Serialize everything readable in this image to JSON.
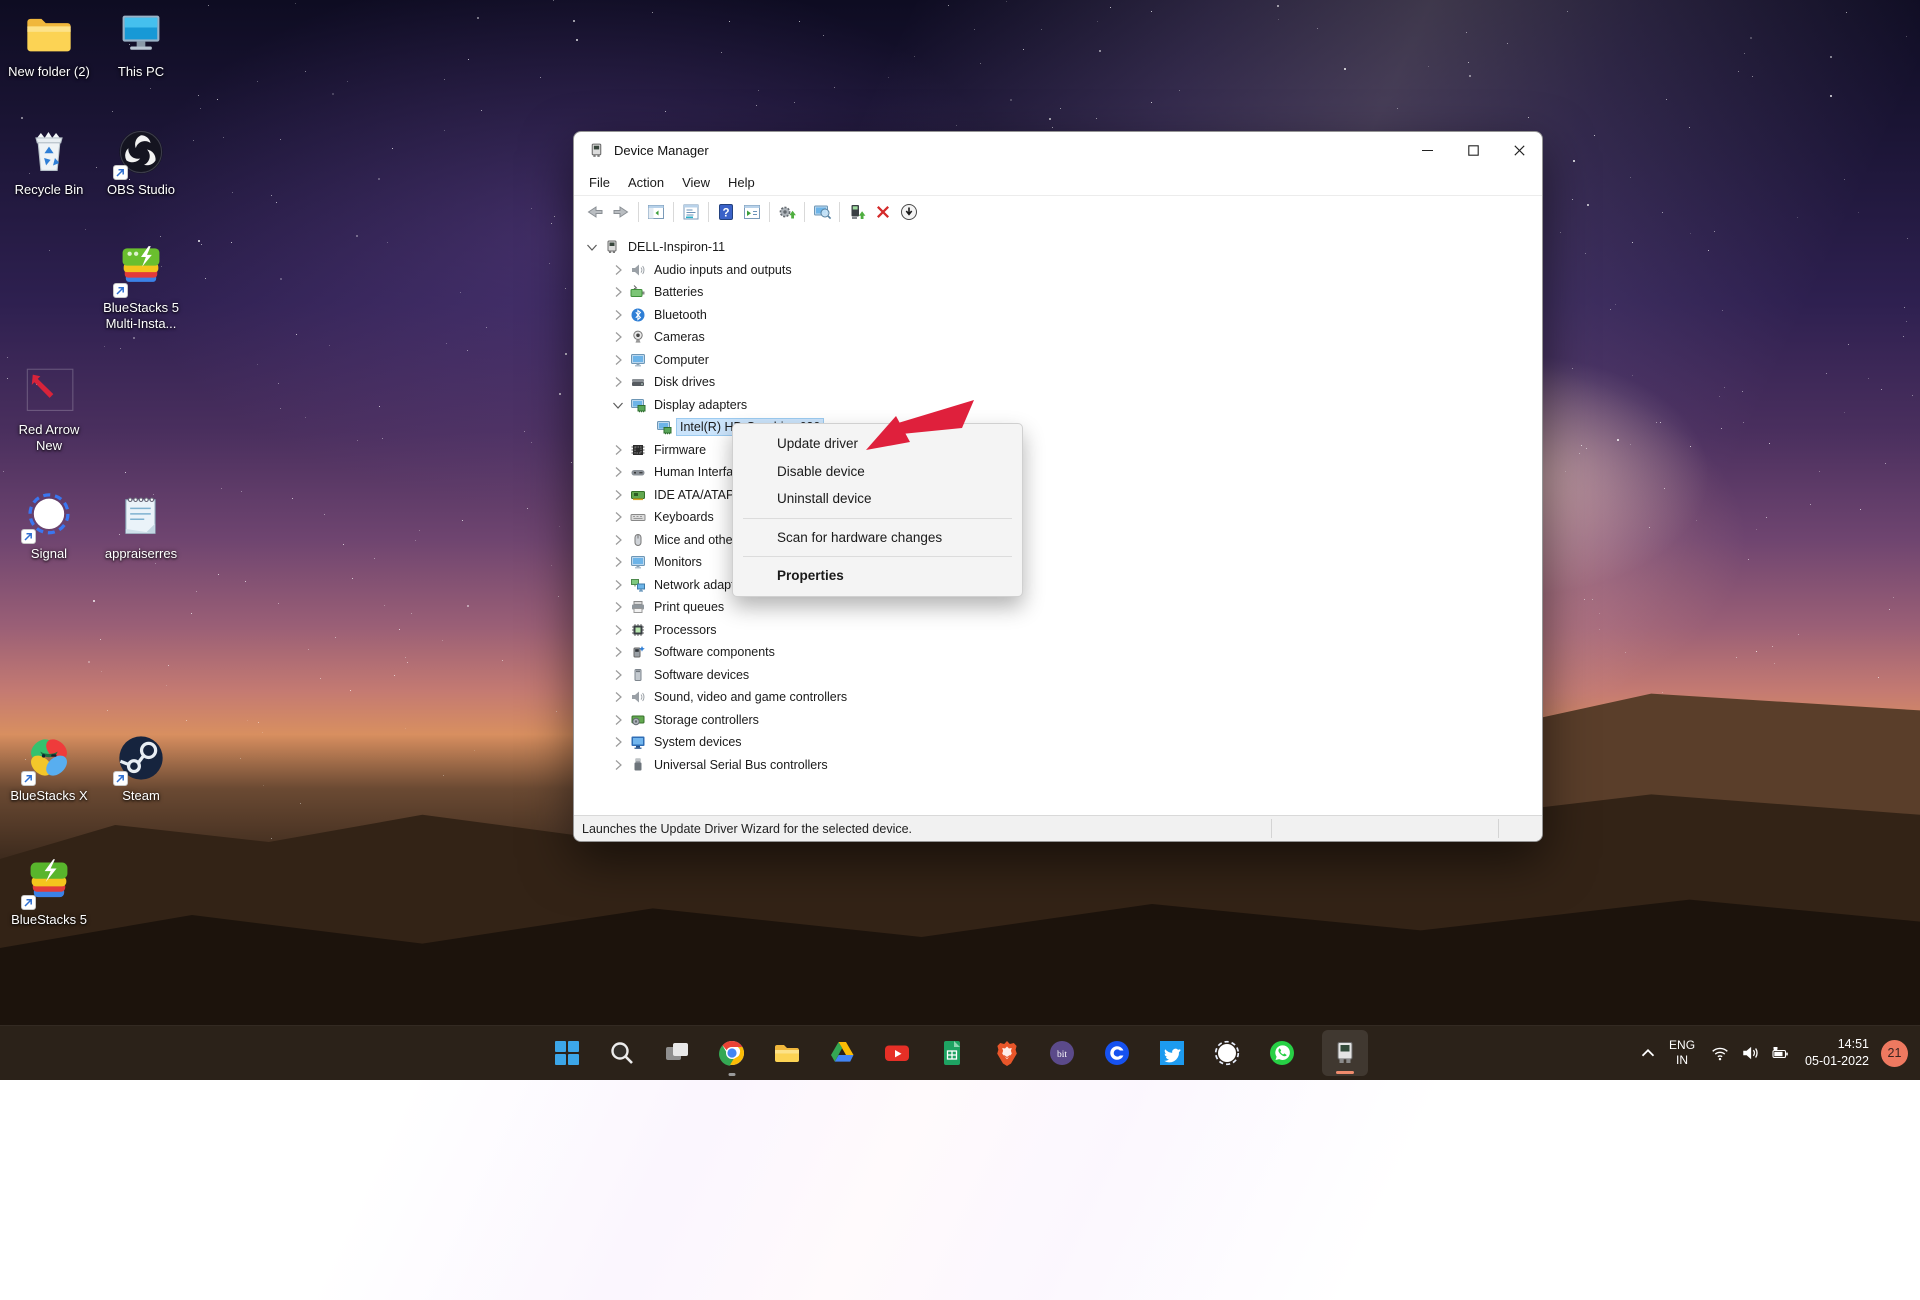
{
  "desktop_icons": [
    {
      "label": "New folder (2)",
      "icon": "folder",
      "shortcut": false
    },
    {
      "label": "This PC",
      "icon": "this-pc",
      "shortcut": false
    },
    {
      "label": "Recycle Bin",
      "icon": "recycle-bin",
      "shortcut": false
    },
    {
      "label": "OBS Studio",
      "icon": "obs",
      "shortcut": true
    },
    {
      "label": "BlueStacks 5 Multi-Insta...",
      "icon": "bluestacks-multi",
      "shortcut": true
    },
    {
      "label": "Red Arrow New",
      "icon": "red-arrow-image",
      "shortcut": false
    },
    {
      "label": "Signal",
      "icon": "signal",
      "shortcut": true
    },
    {
      "label": "appraiserres",
      "icon": "notepad-file",
      "shortcut": false
    },
    {
      "label": "BlueStacks X",
      "icon": "bluestacks-x",
      "shortcut": true
    },
    {
      "label": "Steam",
      "icon": "steam",
      "shortcut": true
    },
    {
      "label": "BlueStacks 5",
      "icon": "bluestacks-5",
      "shortcut": true
    }
  ],
  "device_manager": {
    "title": "Device Manager",
    "menu": [
      "File",
      "Action",
      "View",
      "Help"
    ],
    "toolbar": [
      "back",
      "forward",
      "sep",
      "console-tree",
      "sep",
      "properties-list",
      "sep",
      "help",
      "export-list",
      "sep",
      "update-driver-gear",
      "sep",
      "scan-hardware",
      "sep",
      "update-driver-device",
      "uninstall-x",
      "disable-down"
    ],
    "tree": [
      {
        "label": "DELL-Inspiron-11",
        "level": 0,
        "icon": "computer-root",
        "chevron": "expanded",
        "selected": false
      },
      {
        "label": "Audio inputs and outputs",
        "level": 1,
        "icon": "speaker",
        "chevron": "collapsed",
        "selected": false
      },
      {
        "label": "Batteries",
        "level": 1,
        "icon": "battery",
        "chevron": "collapsed",
        "selected": false
      },
      {
        "label": "Bluetooth",
        "level": 1,
        "icon": "bluetooth",
        "chevron": "collapsed",
        "selected": false
      },
      {
        "label": "Cameras",
        "level": 1,
        "icon": "camera",
        "chevron": "collapsed",
        "selected": false
      },
      {
        "label": "Computer",
        "level": 1,
        "icon": "monitor",
        "chevron": "collapsed",
        "selected": false
      },
      {
        "label": "Disk drives",
        "level": 1,
        "icon": "disk",
        "chevron": "collapsed",
        "selected": false
      },
      {
        "label": "Display adapters",
        "level": 1,
        "icon": "display-adapter",
        "chevron": "expanded",
        "selected": false
      },
      {
        "label": "Intel(R) HD Graphics 620",
        "level": 2,
        "icon": "display-adapter",
        "chevron": "none",
        "selected": true
      },
      {
        "label": "Firmware",
        "level": 1,
        "icon": "firmware",
        "chevron": "collapsed",
        "selected": false
      },
      {
        "label": "Human Interface Devices",
        "level": 1,
        "icon": "hid",
        "chevron": "collapsed",
        "selected": false
      },
      {
        "label": "IDE ATA/ATAPI controllers",
        "level": 1,
        "icon": "ide",
        "chevron": "collapsed",
        "selected": false
      },
      {
        "label": "Keyboards",
        "level": 1,
        "icon": "keyboard",
        "chevron": "collapsed",
        "selected": false
      },
      {
        "label": "Mice and other pointing devices",
        "level": 1,
        "icon": "mouse",
        "chevron": "collapsed",
        "selected": false
      },
      {
        "label": "Monitors",
        "level": 1,
        "icon": "monitor2",
        "chevron": "collapsed",
        "selected": false
      },
      {
        "label": "Network adapters",
        "level": 1,
        "icon": "network",
        "chevron": "collapsed",
        "selected": false
      },
      {
        "label": "Print queues",
        "level": 1,
        "icon": "printer",
        "chevron": "collapsed",
        "selected": false
      },
      {
        "label": "Processors",
        "level": 1,
        "icon": "processor",
        "chevron": "collapsed",
        "selected": false
      },
      {
        "label": "Software components",
        "level": 1,
        "icon": "software-component",
        "chevron": "collapsed",
        "selected": false
      },
      {
        "label": "Software devices",
        "level": 1,
        "icon": "software-device",
        "chevron": "collapsed",
        "selected": false
      },
      {
        "label": "Sound, video and game controllers",
        "level": 1,
        "icon": "speaker2",
        "chevron": "collapsed",
        "selected": false
      },
      {
        "label": "Storage controllers",
        "level": 1,
        "icon": "storage",
        "chevron": "collapsed",
        "selected": false
      },
      {
        "label": "System devices",
        "level": 1,
        "icon": "system",
        "chevron": "collapsed",
        "selected": false
      },
      {
        "label": "Universal Serial Bus controllers",
        "level": 1,
        "icon": "usb",
        "chevron": "collapsed",
        "selected": false
      }
    ],
    "status_text": "Launches the Update Driver Wizard for the selected device."
  },
  "context_menu": {
    "items": [
      {
        "type": "item",
        "label": "Update driver",
        "bold": false
      },
      {
        "type": "item",
        "label": "Disable device",
        "bold": false
      },
      {
        "type": "item",
        "label": "Uninstall device",
        "bold": false
      },
      {
        "type": "separator"
      },
      {
        "type": "item",
        "label": "Scan for hardware changes",
        "bold": false
      },
      {
        "type": "separator"
      },
      {
        "type": "item",
        "label": "Properties",
        "bold": true
      }
    ]
  },
  "taskbar": {
    "items": [
      {
        "name": "start",
        "running": false,
        "active": false
      },
      {
        "name": "search",
        "running": false,
        "active": false
      },
      {
        "name": "task-view",
        "running": false,
        "active": false
      },
      {
        "name": "chrome",
        "running": true,
        "active": false
      },
      {
        "name": "file-explorer",
        "running": false,
        "active": false
      },
      {
        "name": "google-drive",
        "running": false,
        "active": false
      },
      {
        "name": "youtube",
        "running": false,
        "active": false
      },
      {
        "name": "google-sheets",
        "running": false,
        "active": false
      },
      {
        "name": "brave",
        "running": false,
        "active": false
      },
      {
        "name": "bit",
        "running": false,
        "active": false
      },
      {
        "name": "coinbase",
        "running": false,
        "active": false
      },
      {
        "name": "twitter",
        "running": false,
        "active": false
      },
      {
        "name": "signal",
        "running": false,
        "active": false
      },
      {
        "name": "whatsapp",
        "running": false,
        "active": false
      },
      {
        "name": "device-manager",
        "running": false,
        "active": true
      }
    ]
  },
  "tray": {
    "language_line1": "ENG",
    "language_line2": "IN",
    "time": "14:51",
    "date": "05-01-2022",
    "notification_count": "21"
  },
  "colors": {
    "selection": "#cbe4fb",
    "taskbar": "#2b2219",
    "badge": "#ee7960",
    "annotation_arrow": "#df203c"
  }
}
